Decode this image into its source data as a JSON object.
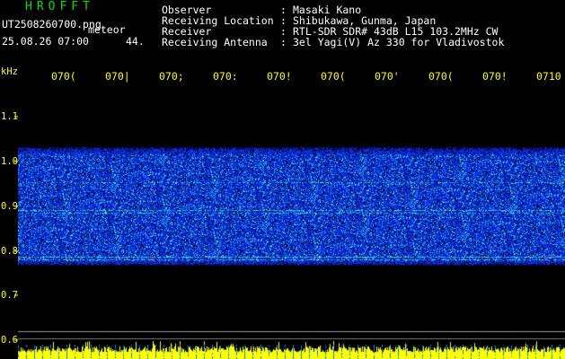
{
  "app": {
    "name": "HROFFT"
  },
  "file": {
    "name": "UT2508260700.png",
    "type_label": "meteor",
    "datetime": "25.08.26 07:00",
    "count": "44."
  },
  "info": [
    {
      "label": "Observer",
      "sep": ":",
      "value": "Masaki Kano"
    },
    {
      "label": "Receiving Location",
      "sep": ":",
      "value": "Shibukawa, Gunma, Japan"
    },
    {
      "label": "Receiver",
      "sep": ":",
      "value": "RTL-SDR SDR# 43dB L15 103.2MHz CW"
    },
    {
      "label": "Receiving Antenna",
      "sep": ":",
      "value": "3el Yagi(V) Az 330 for Vladivostok"
    }
  ],
  "freq_axis": {
    "unit": "kHz",
    "ticks": [
      "1.1",
      "1.0",
      "0.9",
      "0.8",
      "0.7",
      "0.6"
    ]
  },
  "time_axis": {
    "ticks": [
      "070(",
      "070|",
      "070;",
      "070:",
      "070!",
      "070(",
      "070'",
      "070(",
      "070!",
      "0710"
    ]
  },
  "colors": {
    "background": "#000000",
    "header_title": "#00e000",
    "header_text": "#ffffff",
    "axis_text": "#ffff00",
    "noise_base": "#0a1fe0",
    "echo_line": "#00e0ff",
    "hot_echo": "#ff2020",
    "baseline": "#ffff00"
  }
}
